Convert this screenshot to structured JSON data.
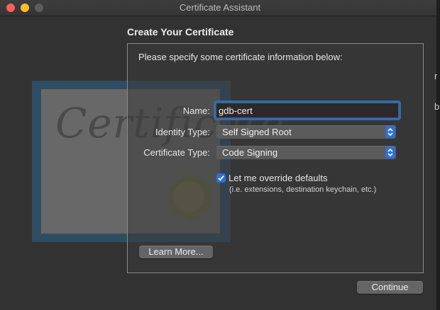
{
  "window": {
    "title": "Certificate Assistant"
  },
  "art": {
    "script_text": "Certificate"
  },
  "heading": "Create Your Certificate",
  "intro": "Please specify some certificate information below:",
  "form": {
    "name_label": "Name:",
    "name_value": "gdb-cert",
    "identity_label": "Identity Type:",
    "identity_value": "Self Signed Root",
    "cert_type_label": "Certificate Type:",
    "cert_type_value": "Code Signing",
    "override_label": "Let me override defaults",
    "override_checked": true,
    "override_hint": "(i.e. extensions, destination keychain, etc.)"
  },
  "buttons": {
    "learn_more": "Learn More...",
    "continue": "Continue"
  },
  "edge_glyphs": {
    "top": "r",
    "bottom": "b"
  },
  "colors": {
    "accent": "#2f6fd6",
    "focus_ring": "#2d6db3",
    "close": "#fe5f57",
    "minimize": "#febc2e"
  }
}
